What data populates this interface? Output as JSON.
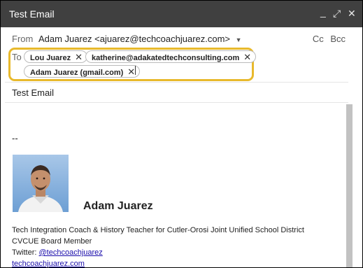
{
  "window": {
    "title": "Test Email",
    "minimize_glyph": "_",
    "popout_glyph": "⤢",
    "close_glyph": "✕"
  },
  "from": {
    "label": "From",
    "value": "Adam Juarez <ajuarez@techcoachjuarez.com>",
    "caret": "▼"
  },
  "cc_label": "Cc",
  "bcc_label": "Bcc",
  "to": {
    "label": "To",
    "recipients": [
      "Lou Juarez",
      "katherine@adakatedtechconsulting.com",
      "Adam Juarez (gmail.com)"
    ],
    "remove_glyph": "✕"
  },
  "subject": "Test Email",
  "body": {
    "dashes": "--",
    "signature": {
      "name": "Adam Juarez",
      "title": "Tech Integration Coach & History Teacher for Cutler-Orosi Joint Unified School District",
      "role": "CVCUE Board Member",
      "twitter_label": "Twitter: ",
      "twitter_handle": "@techcoachjuarez",
      "website": "techcoachjuarez.com"
    }
  },
  "colors": {
    "titlebar": "#404040",
    "highlight_border": "#e8b92c",
    "link": "#1a0dab"
  }
}
